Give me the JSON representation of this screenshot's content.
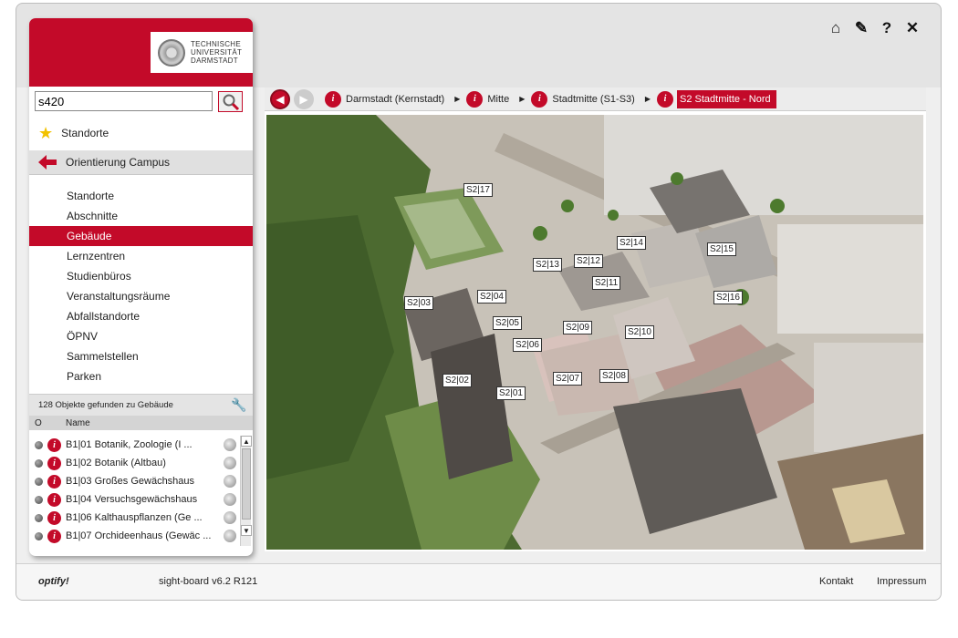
{
  "top_icons": [
    {
      "name": "home-icon",
      "glyph": "⌂"
    },
    {
      "name": "tools-icon",
      "glyph": "✎"
    },
    {
      "name": "help-icon",
      "glyph": "?"
    },
    {
      "name": "close-icon",
      "glyph": "✕"
    }
  ],
  "brand": {
    "logo_line1": "TECHNISCHE",
    "logo_line2": "UNIVERSITÄT",
    "logo_line3": "DARMSTADT"
  },
  "search": {
    "value": "s420"
  },
  "favorites": {
    "label": "Standorte"
  },
  "orientation": {
    "label": "Orientierung Campus"
  },
  "categories": [
    {
      "label": "Standorte",
      "selected": false
    },
    {
      "label": "Abschnitte",
      "selected": false
    },
    {
      "label": "Gebäude",
      "selected": true
    },
    {
      "label": "Lernzentren",
      "selected": false
    },
    {
      "label": "Studienbüros",
      "selected": false
    },
    {
      "label": "Veranstaltungsräume",
      "selected": false
    },
    {
      "label": "Abfallstandorte",
      "selected": false
    },
    {
      "label": "ÖPNV",
      "selected": false
    },
    {
      "label": "Sammelstellen",
      "selected": false
    },
    {
      "label": "Parken",
      "selected": false
    }
  ],
  "results": {
    "count_text": "128 Objekte gefunden zu Gebäude",
    "col_status": "O",
    "col_name": "Name",
    "rows": [
      "B1|01 Botanik, Zoologie (I ...",
      "B1|02 Botanik (Altbau)",
      "B1|03 Großes Gewächshaus",
      "B1|04 Versuchsgewächshaus",
      "B1|06 Kalthauspflanzen (Ge ...",
      "B1|07 Orchideenhaus (Gewäc ..."
    ]
  },
  "breadcrumbs": [
    "Darmstadt (Kernstadt)",
    "Mitte",
    "Stadtmitte (S1-S3)",
    "S2 Stadtmitte - Nord"
  ],
  "map_labels": [
    "S2|17",
    "S2|14",
    "S2|15",
    "S2|13",
    "S2|12",
    "S2|11",
    "S2|16",
    "S2|03",
    "S2|04",
    "S2|05",
    "S2|09",
    "S2|10",
    "S2|06",
    "S2|07",
    "S2|08",
    "S2|02",
    "S2|01"
  ],
  "footer": {
    "brand": "optify!",
    "version": "sight-board v6.2 R121",
    "contact": "Kontakt",
    "imprint": "Impressum"
  },
  "colors": {
    "accent": "#c30a29"
  }
}
